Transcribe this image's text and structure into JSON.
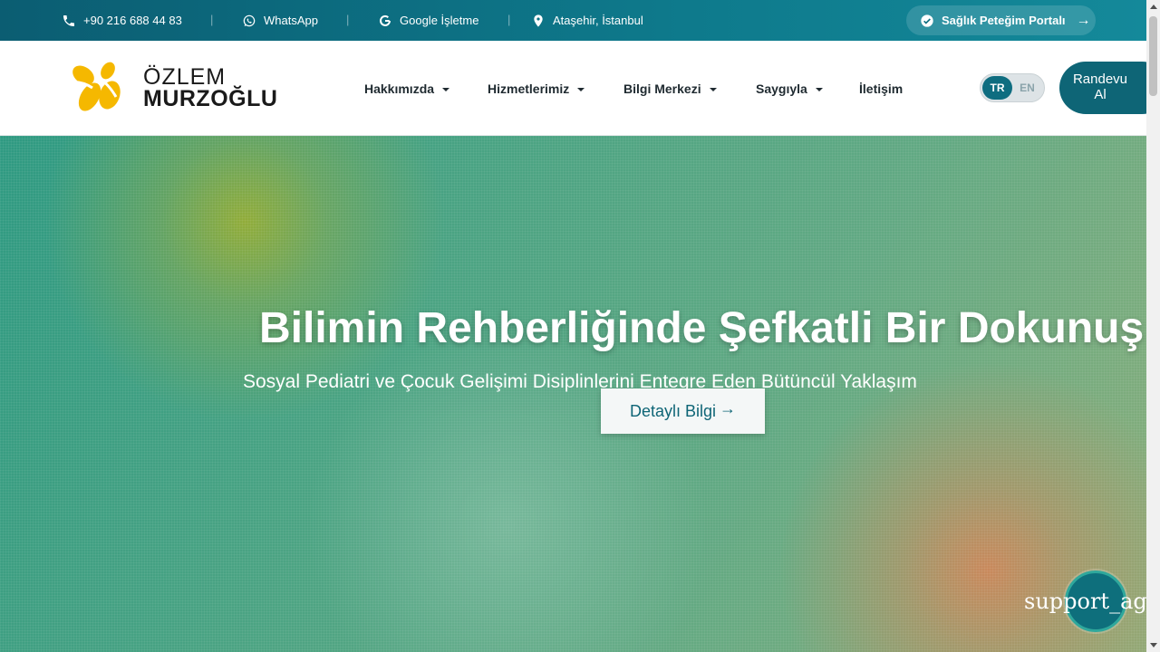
{
  "topbar": {
    "phone": "+90 216 688 44 83",
    "whatsapp": "WhatsApp",
    "google": "Google İşletme",
    "location": "Ataşehir, İstanbul",
    "separator": "|",
    "portal_label": "Sağlık Peteğim Portalı",
    "portal_arrow": "→"
  },
  "header": {
    "logo_top": "ÖZLEM",
    "logo_bottom": "MURZOĞLU",
    "nav": [
      {
        "label": "Hakkımızda"
      },
      {
        "label": "Hizmetlerimiz"
      },
      {
        "label": "Bilgi Merkezi"
      },
      {
        "label": "Saygıyla"
      },
      {
        "label": "İletişim"
      }
    ],
    "lang_tr": "TR",
    "lang_en": "EN",
    "cta_line1": "Randevu",
    "cta_line2": "Al"
  },
  "hero": {
    "title": "Bilimin Rehberliğinde Şefkatli Bir Dokunuş",
    "subtitle": "Sosyal Pediatri ve Çocuk Gelişimi Disiplinlerini Entegre Eden Bütüncül Yaklaşım",
    "button_label": "Detaylı Bilgi",
    "button_arrow": "→"
  },
  "support": {
    "label": "support_agent"
  },
  "colors": {
    "primary": "#0e6576",
    "topbar": "#0b5d72",
    "logo_yellow": "#f5b800"
  }
}
